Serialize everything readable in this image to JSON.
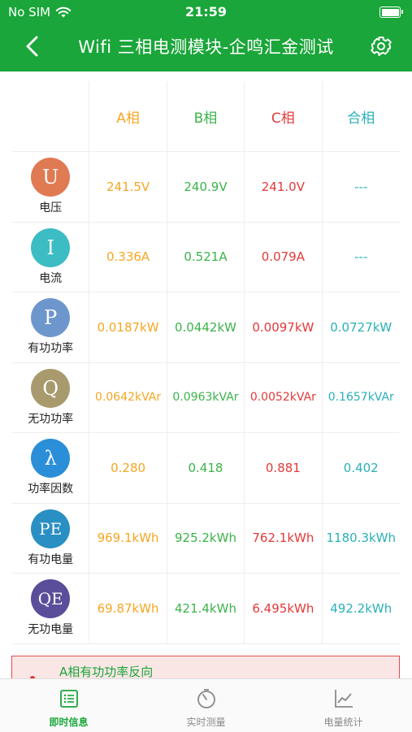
{
  "status_bar": {
    "carrier": "No SIM",
    "time": "21:59"
  },
  "header": {
    "title": "Wifi 三相电测模块-企鸣汇金测试",
    "back_icon": "chevron-left-icon",
    "settings_icon": "gear-icon"
  },
  "table": {
    "columns": [
      "A相",
      "B相",
      "C相",
      "合相"
    ],
    "column_colors": [
      "#f5a623",
      "#3cb34a",
      "#e23a3a",
      "#2ab0b8"
    ],
    "rows": [
      {
        "symbol": "U",
        "label": "电压",
        "circle_color": "#e07a52",
        "values": [
          "241.5V",
          "240.9V",
          "241.0V",
          "---"
        ]
      },
      {
        "symbol": "I",
        "label": "电流",
        "circle_color": "#3cbcc3",
        "values": [
          "0.336A",
          "0.521A",
          "0.079A",
          "---"
        ]
      },
      {
        "symbol": "P",
        "label": "有功功率",
        "circle_color": "#6d97cc",
        "values": [
          "0.0187kW",
          "0.0442kW",
          "0.0097kW",
          "0.0727kW"
        ]
      },
      {
        "symbol": "Q",
        "label": "无功功率",
        "circle_color": "#a89a6c",
        "values": [
          "0.0642kVAr",
          "0.0963kVAr",
          "0.0052kVAr",
          "0.1657kVAr"
        ]
      },
      {
        "symbol": "λ",
        "label": "功率因数",
        "circle_color": "#2b8ed8",
        "values": [
          "0.280",
          "0.418",
          "0.881",
          "0.402"
        ]
      },
      {
        "symbol": "PE",
        "label": "有功电量",
        "circle_color": "#2a8fc2",
        "values": [
          "969.1kWh",
          "925.2kWh",
          "762.1kWh",
          "1180.3kWh"
        ]
      },
      {
        "symbol": "QE",
        "label": "无功电量",
        "circle_color": "#5a4d9a",
        "values": [
          "69.87kWh",
          "421.4kWh",
          "6.495kWh",
          "492.2kWh"
        ]
      }
    ]
  },
  "alert": {
    "message": "A相有功功率反向"
  },
  "tabbar": {
    "tabs": [
      {
        "label": "即时信息",
        "icon": "list-icon",
        "active": true
      },
      {
        "label": "实时测量",
        "icon": "stopwatch-icon",
        "active": false
      },
      {
        "label": "电量统计",
        "icon": "line-chart-icon",
        "active": false
      }
    ],
    "active_color": "#1aa63a",
    "inactive_color": "#8a8a8a"
  }
}
